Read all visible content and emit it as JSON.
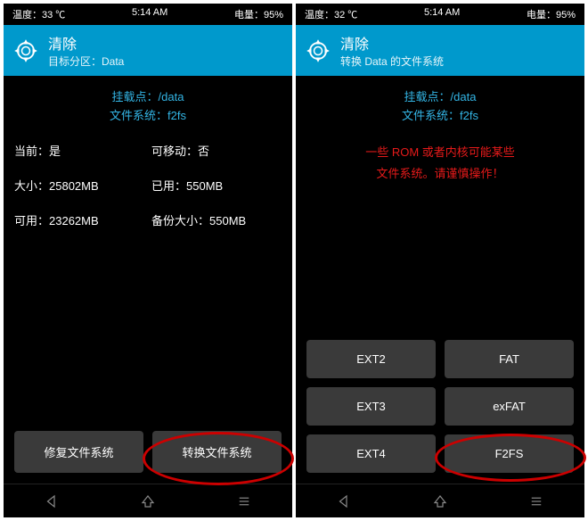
{
  "left": {
    "status": {
      "temp": "温度：33 ℃",
      "time": "5:14 AM",
      "battery": "电量：95%"
    },
    "header": {
      "title": "清除",
      "subtitle": "目标分区：Data"
    },
    "info": {
      "mount": "挂载点：/data",
      "fs": "文件系统：f2fs"
    },
    "stats": {
      "current": "当前：是",
      "removable": "可移动：否",
      "size": "大小：25802MB",
      "used": "已用：550MB",
      "free": "可用：23262MB",
      "backup": "备份大小：550MB"
    },
    "buttons": {
      "repair": "修复文件系统",
      "change": "转换文件系统"
    }
  },
  "right": {
    "status": {
      "temp": "温度：32 ℃",
      "time": "5:14 AM",
      "battery": "电量：95%"
    },
    "header": {
      "title": "清除",
      "subtitle": "转换 Data 的文件系统"
    },
    "info": {
      "mount": "挂载点：/data",
      "fs": "文件系统：f2fs"
    },
    "warning": {
      "line1": "一些 ROM 或者内核可能某些",
      "line2": "文件系统。请谨慎操作！"
    },
    "fs": {
      "ext2": "EXT2",
      "fat": "FAT",
      "ext3": "EXT3",
      "exfat": "exFAT",
      "ext4": "EXT4",
      "f2fs": "F2FS"
    }
  }
}
